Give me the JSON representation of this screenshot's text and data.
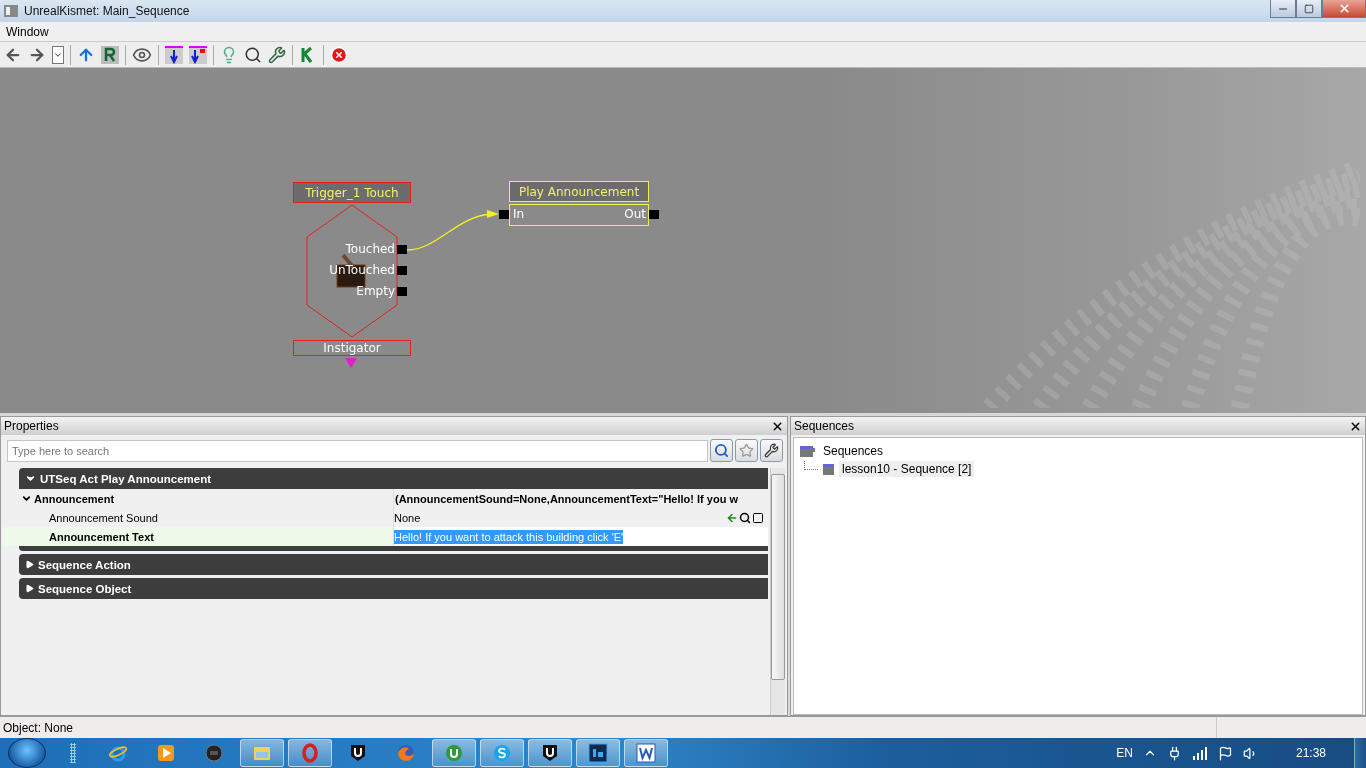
{
  "window": {
    "title": "UnrealKismet: Main_Sequence"
  },
  "menu": [
    {
      "label": "Window"
    }
  ],
  "canvas": {
    "trigger": {
      "title": "Trigger_1 Touch",
      "outputs": [
        "Touched",
        "UnTouched",
        "Empty"
      ],
      "variable": "Instigator"
    },
    "action": {
      "title": "Play Announcement",
      "inputs": [
        "In"
      ],
      "outputs": [
        "Out"
      ]
    }
  },
  "properties": {
    "title": "Properties",
    "search": {
      "placeholder": "Type here to search"
    },
    "categories": [
      {
        "label": "UTSeq Act Play Announcement",
        "expanded": true,
        "rows": [
          {
            "name": "Announcement",
            "value": "(AnnouncementSound=None,AnnouncementText=\"Hello! If you w",
            "expanded": true,
            "selected": false,
            "children": [
              {
                "name": "Announcement Sound",
                "value": "None",
                "selected": false,
                "kind": "object"
              },
              {
                "name": "Announcement Text",
                "value": "Hello! If you want to attack this building click 'E'",
                "selected": true,
                "kind": "text"
              }
            ]
          }
        ]
      },
      {
        "label": "Sequence Action",
        "expanded": false
      },
      {
        "label": "Sequence Object",
        "expanded": false
      }
    ]
  },
  "sequences": {
    "title": "Sequences",
    "tree": [
      {
        "label": "Sequences",
        "children": [
          {
            "label": "lesson10 - Sequence [2]",
            "selected": true
          }
        ]
      }
    ]
  },
  "status_bar": {
    "text": "Object: None"
  },
  "taskbar": {
    "apps": [
      {
        "kind": "ie",
        "open": false
      },
      {
        "kind": "media",
        "open": false
      },
      {
        "kind": "camera",
        "open": false
      },
      {
        "kind": "folder",
        "open": true
      },
      {
        "kind": "opera",
        "open": true
      },
      {
        "kind": "unreal",
        "open": false
      },
      {
        "kind": "firefox",
        "open": false
      },
      {
        "kind": "torrent",
        "open": true
      },
      {
        "kind": "skype",
        "open": true
      },
      {
        "kind": "unreal",
        "open": true
      },
      {
        "kind": "photoshop",
        "open": true
      },
      {
        "kind": "word",
        "open": true
      }
    ],
    "language": "EN",
    "clock": "21:38"
  }
}
